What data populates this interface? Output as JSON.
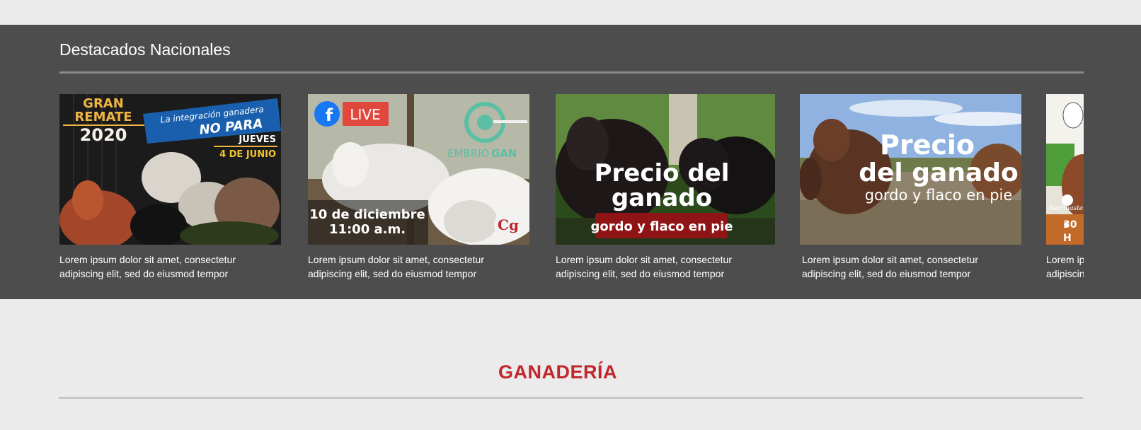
{
  "featured": {
    "title": "Destacados Nacionales",
    "cards": [
      {
        "caption": "Lorem ipsum dolor sit amet, consectetur adipiscing elit, sed do eiusmod tempor",
        "image": {
          "line1": "GRAN",
          "line2": "REMATE",
          "year": "2020",
          "banner1": "La integración ganadera",
          "banner2": "NO PARA",
          "day": "JUEVES",
          "date": "4 DE JUNIO"
        }
      },
      {
        "caption": "Lorem ipsum dolor sit amet, consectetur adipiscing elit, sed do eiusmod tempor",
        "image": {
          "live": "LIVE",
          "brand_a": "EMBRIO",
          "brand_b": "GAN",
          "date": "10 de diciembre",
          "time": "11:00 a.m.",
          "badge": "Cg"
        }
      },
      {
        "caption": "Lorem ipsum dolor sit amet, consectetur adipiscing elit, sed do eiusmod tempor",
        "image": {
          "line1": "Precio del",
          "line2": "ganado",
          "tag": "gordo y flaco en pie"
        }
      },
      {
        "caption": "Lorem ipsum dolor sit amet, consectetur adipiscing elit, sed do eiusmod tempor",
        "image": {
          "line1": "Precio",
          "line2": "del ganado",
          "line3": "gordo y flaco en pie"
        }
      },
      {
        "caption": "Lorem ipsum dolor sit amet, consectetur adipiscing elit, sed do eiusmod tempor",
        "image": {
          "brand": "Beefmaster",
          "number": "30",
          "letter": "H"
        }
      }
    ]
  },
  "section": {
    "title": "GANADERÍA"
  },
  "colors": {
    "band": "#4d4d4d",
    "page": "#ebebeb",
    "accent": "#c1272d",
    "live_red": "#e0483e",
    "facebook_blue": "#1877f2"
  }
}
